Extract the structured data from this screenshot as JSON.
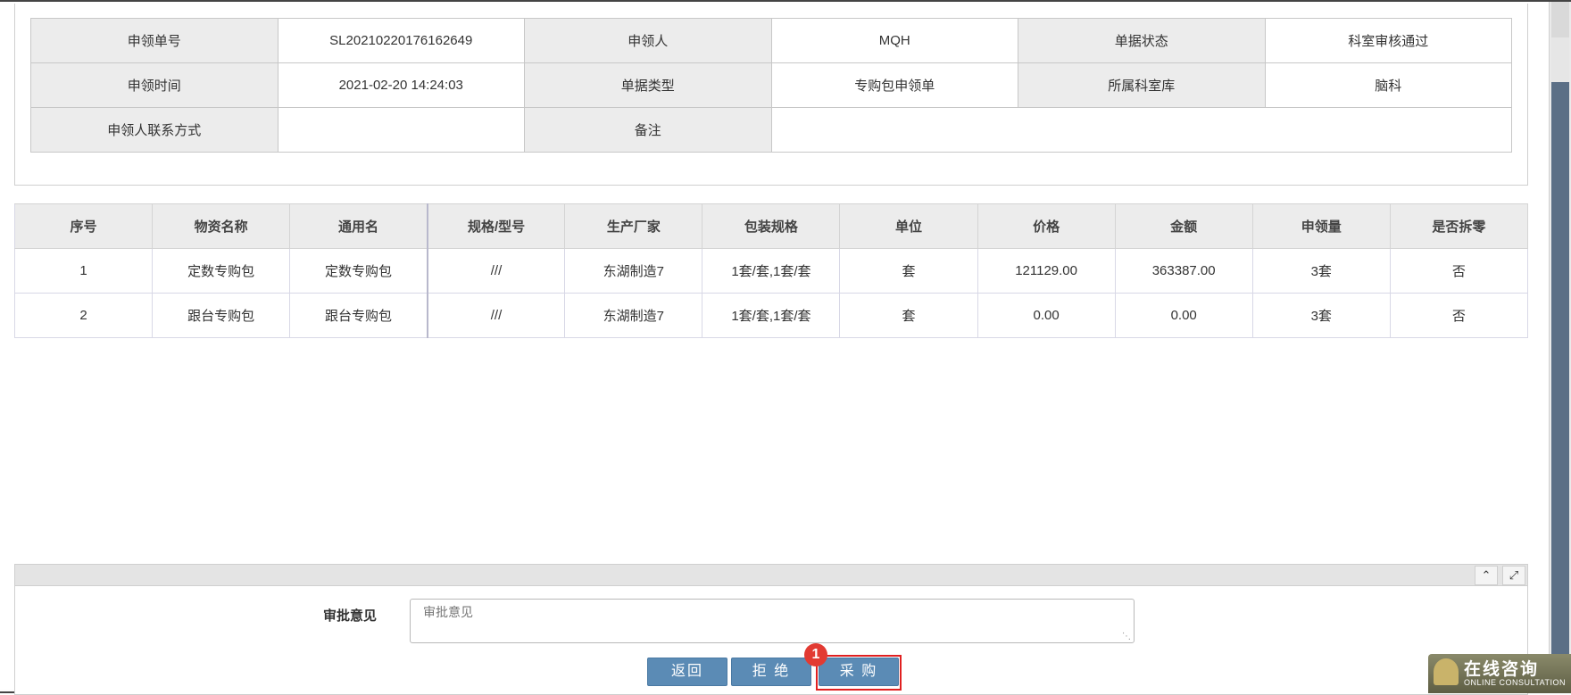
{
  "info": {
    "rows": [
      [
        {
          "label": "申领单号",
          "value": "SL20210220176162649"
        },
        {
          "label": "申领人",
          "value": "MQH"
        },
        {
          "label": "单据状态",
          "value": "科室审核通过"
        }
      ],
      [
        {
          "label": "申领时间",
          "value": "2021-02-20 14:24:03"
        },
        {
          "label": "单据类型",
          "value": "专购包申领单"
        },
        {
          "label": "所属科室库",
          "value": "脑科"
        }
      ],
      [
        {
          "label": "申领人联系方式",
          "value": ""
        },
        {
          "label": "备注",
          "value": ""
        }
      ]
    ]
  },
  "items": {
    "headers": [
      "序号",
      "物资名称",
      "通用名",
      "规格/型号",
      "生产厂家",
      "包装规格",
      "单位",
      "价格",
      "金额",
      "申领量",
      "是否拆零"
    ],
    "rows": [
      [
        "1",
        "定数专购包",
        "定数专购包",
        "///",
        "东湖制造7",
        "1套/套,1套/套",
        "套",
        "121129.00",
        "363387.00",
        "3套",
        "否"
      ],
      [
        "2",
        "跟台专购包",
        "跟台专购包",
        "///",
        "东湖制造7",
        "1套/套,1套/套",
        "套",
        "0.00",
        "0.00",
        "3套",
        "否"
      ]
    ]
  },
  "approval": {
    "label": "审批意见",
    "placeholder": "审批意见",
    "value": "",
    "buttons": {
      "back": "返回",
      "reject": "拒 绝",
      "purchase": "采 购"
    },
    "step_badge": "1",
    "panel_icons": {
      "collapse": "chevron-up-icon",
      "expand": "expand-icon"
    }
  },
  "consult": {
    "cn": "在线咨询",
    "en": "ONLINE CONSULTATION"
  },
  "colors": {
    "button": "#5b8bb5",
    "highlight": "#e02020",
    "header_bg": "#ececec",
    "scroll_thumb": "#5b6f86"
  }
}
